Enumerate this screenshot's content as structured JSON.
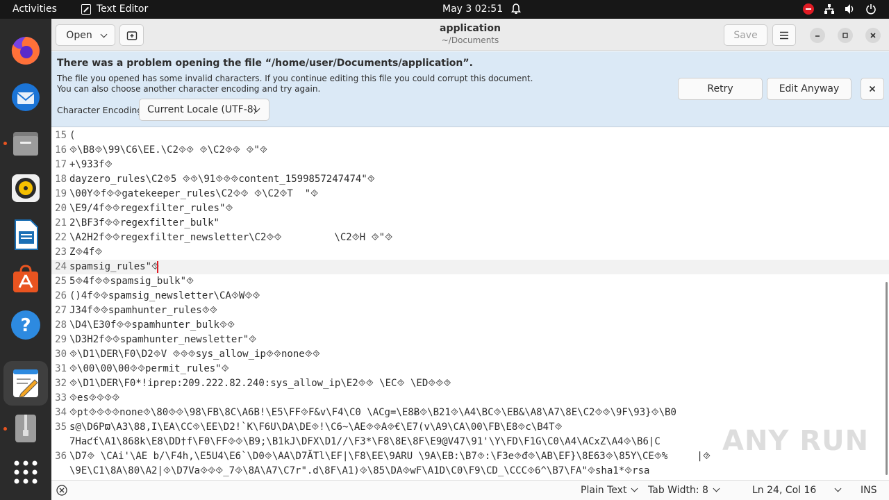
{
  "topbar": {
    "activities": "Activities",
    "app_name": "Text Editor",
    "clock": "May 3  02:51",
    "icons": [
      "bell-icon",
      "power-alert-icon",
      "network-icon",
      "volume-icon",
      "power-icon"
    ]
  },
  "dock": {
    "apps": [
      {
        "name": "Firefox",
        "icon": "firefox-icon",
        "running": false
      },
      {
        "name": "Thunderbird",
        "icon": "thunderbird-icon",
        "running": false
      },
      {
        "name": "Files",
        "icon": "files-icon",
        "running": true
      },
      {
        "name": "Rhythmbox",
        "icon": "rhythmbox-icon",
        "running": false
      },
      {
        "name": "LibreOffice Writer",
        "icon": "writer-icon",
        "running": false
      },
      {
        "name": "Ubuntu Software",
        "icon": "software-icon",
        "running": false
      },
      {
        "name": "Help",
        "icon": "help-icon",
        "running": false
      },
      {
        "name": "Text Editor",
        "icon": "text-editor-icon",
        "running": true,
        "active": true
      },
      {
        "name": "Archive",
        "icon": "archive-icon",
        "running": true
      },
      {
        "name": "Show Applications",
        "icon": "app-grid-icon",
        "running": false
      }
    ]
  },
  "header": {
    "open_label": "Open",
    "title": "application",
    "subtitle": "~/Documents",
    "save_label": "Save"
  },
  "infobar": {
    "title": "There was a problem opening the file “/home/user/Documents/application”.",
    "message_line1": "The file you opened has some invalid characters. If you continue editing this file you could corrupt this document.",
    "message_line2": "You can also choose another character encoding and try again.",
    "encoding_label": "Character Encoding:",
    "encoding_value": "Current Locale (UTF-8)",
    "retry_label": "Retry",
    "edit_anyway_label": "Edit Anyway"
  },
  "editor": {
    "current_line": 24,
    "lines": [
      {
        "n": "15",
        "text": "("
      },
      {
        "n": "16",
        "text": "⯑\\B8⯑\\99\\C6\\EE.\\C2⯑⯑ ⯑\\C2⯑⯑ ⯑\"⯑"
      },
      {
        "n": "17",
        "text": "+\\933f⯑"
      },
      {
        "n": "18",
        "text": "dayzero_rules\\C2⯑5 ⯑⯑\\91⯑⯑⯑content_1599857247474\"⯑"
      },
      {
        "n": "19",
        "text": "\\00Y⯑f⯑⯑gatekeeper_rules\\C2⯑⯑ ⯑\\C2⯑T  \"⯑"
      },
      {
        "n": "20",
        "text": "\\E9/4f⯑⯑regexfilter_rules\"⯑"
      },
      {
        "n": "21",
        "text": "2\\BF3f⯑⯑regexfilter_bulk\""
      },
      {
        "n": "22",
        "text": "\\A2H2f⯑⯑regexfilter_newsletter\\C2⯑⯑         \\C2⯑H ⯑\"⯑"
      },
      {
        "n": "23",
        "text": "Z⯑4f⯑"
      },
      {
        "n": "24",
        "text": "spamsig_rules\"⯑"
      },
      {
        "n": "25",
        "text": "5⯑4f⯑⯑spamsig_bulk\"⯑"
      },
      {
        "n": "26",
        "text": "()4f⯑⯑spamsig_newsletter\\CA⯑W⯑⯑"
      },
      {
        "n": "27",
        "text": "J34f⯑⯑spamhunter_rules⯑⯑"
      },
      {
        "n": "28",
        "text": "\\D4\\E30f⯑⯑spamhunter_bulk⯑⯑"
      },
      {
        "n": "29",
        "text": "\\D3H2f⯑⯑spamhunter_newsletter\"⯑"
      },
      {
        "n": "30",
        "text": "⯑\\D1\\DER\\F0\\D2⯑V ⯑⯑⯑sys_allow_ip⯑⯑none⯑⯑"
      },
      {
        "n": "31",
        "text": "⯑\\00\\00\\00⯑⯑permit_rules\"⯑"
      },
      {
        "n": "32",
        "text": "⯑\\D1\\DER\\F0*!iprep:209.222.82.240:sys_allow_ip\\E2⯑⯑ \\EC⯑ \\ED⯑⯑⯑"
      },
      {
        "n": "33",
        "text": "⯑es⯑⯑⯑⯑"
      },
      {
        "n": "34",
        "text": "⯑pt⯑⯑⯑⯑none⯑\\80⯑⯑\\98\\FB\\8C\\A6B!\\E5\\FF⯑F&v\\F4\\C0 \\ACg=\\E8Ƀ⯑\\B21⯑\\A4\\BC⯑\\EB&\\A8\\A7\\8E\\C2⯑⯑\\9F\\93}⯑\\B0"
      },
      {
        "n": "35",
        "text": "s@\\D6Pϖ\\A3\\88,I\\EA\\CC⯑\\EE\\D2!`K\\F6U\\DA\\DE⯑!\\C6~\\AE⯑⯑A⯑€\\E7(v\\A9\\CA\\00\\FB\\E8⯑c\\B4T⯑"
      },
      {
        "n": "",
        "text": "7Haƈť\\A1\\868k\\E8\\DD†f\\F0\\FF⯑⯑\\B9;\\B1kJ\\DFX\\D1//\\F3*\\F8\\8E\\8F\\E9@V47\\91'\\Y\\FD\\F1G\\C0\\A4\\ACxZ\\A4⯑\\B6|C"
      },
      {
        "n": "36",
        "text": "\\D7⯑ \\CAi'\\AE b/\\F4h,\\E5U4\\E6`\\D0⯑\\AA\\D7ĂTl\\EF|\\F8\\EE\\9ARU \\9A\\EB:\\B7⯑:\\F3e⯑đ⯑\\AB\\EF}\\8E63⯑\\85Y\\CE⯑%     |⯑"
      },
      {
        "n": "",
        "text": "\\9E\\C1\\8A\\80\\A2|⯑\\D7Va⯑⯑⯑_7⯑\\8A\\A7\\C7r\".d\\8F\\A1)⯑\\85\\DA⯑wF\\A1D\\C0\\F9\\CD_\\CCC⯑6^\\B7\\FA\"⯑sha1*⯑rsa"
      }
    ]
  },
  "watermark": "ANY RUN",
  "statusbar": {
    "language": "Plain Text",
    "tab_width": "Tab Width: 8",
    "position": "Ln 24, Col 16",
    "mode": "INS"
  }
}
